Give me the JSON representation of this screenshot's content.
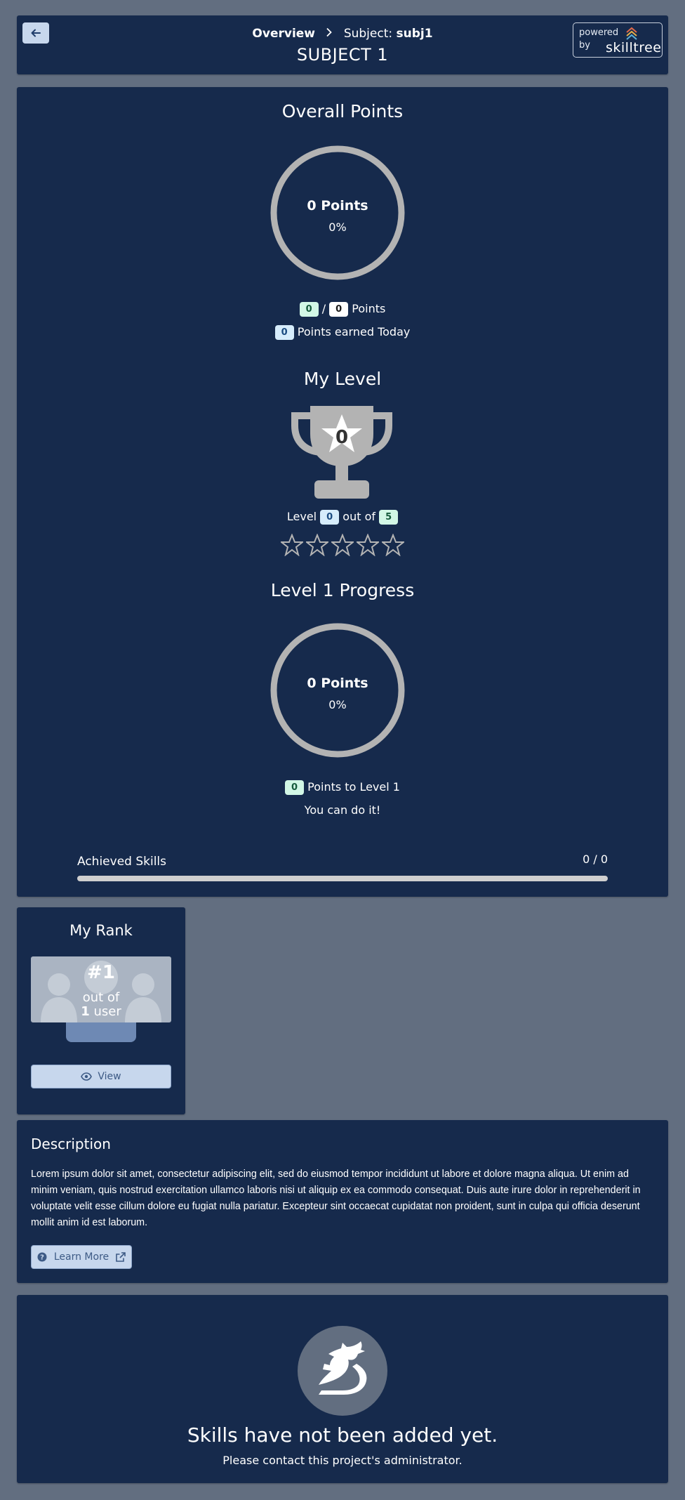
{
  "header": {
    "breadcrumb_overview": "Overview",
    "breadcrumb_subject_prefix": "Subject:",
    "breadcrumb_subject_id": "subj1",
    "title": "SUBJECT 1",
    "powered_line1": "powered",
    "powered_line2": "by",
    "brand": "skilltree"
  },
  "overall_points": {
    "title": "Overall Points",
    "ring_points": "0 Points",
    "ring_percent": "0%",
    "earned": "0",
    "total": "0",
    "slash": "/",
    "points_label": "Points",
    "today": "0",
    "today_label": "Points earned Today"
  },
  "my_level": {
    "title": "My Level",
    "trophy_level": "0",
    "level_label": "Level",
    "current": "0",
    "out_of_label": "out of",
    "max": "5",
    "stars_filled": 0,
    "stars_total": 5
  },
  "level_progress": {
    "title": "Level 1 Progress",
    "ring_points": "0 Points",
    "ring_percent": "0%",
    "to_level": "0",
    "to_level_label": "Points to Level 1",
    "encouragement": "You can do it!"
  },
  "achieved_skills": {
    "label": "Achieved Skills",
    "count": "0 / 0",
    "progress": 0
  },
  "rank": {
    "title": "My Rank",
    "position": "#1",
    "out_of": "out of",
    "users_count": "1",
    "users_label": "user",
    "view_label": "View"
  },
  "description": {
    "title": "Description",
    "body": "Lorem ipsum dolor sit amet, consectetur adipiscing elit, sed do eiusmod tempor incididunt ut labore et dolore magna aliqua. Ut enim ad minim veniam, quis nostrud exercitation ullamco laboris nisi ut aliquip ex ea commodo consequat. Duis aute irure dolor in reprehenderit in voluptate velit esse cillum dolore eu fugiat nulla pariatur. Excepteur sint occaecat cupidatat non proident, sunt in culpa qui officia deserunt mollit anim id est laborum.",
    "learn_more_label": "Learn More"
  },
  "empty_state": {
    "title": "Skills have not been added yet.",
    "subtitle": "Please contact this project's administrator."
  },
  "colors": {
    "page_bg": "#626e80",
    "card_bg": "#162a4c",
    "ring": "#b3b3b3",
    "button_bg": "#c7d7ed"
  }
}
